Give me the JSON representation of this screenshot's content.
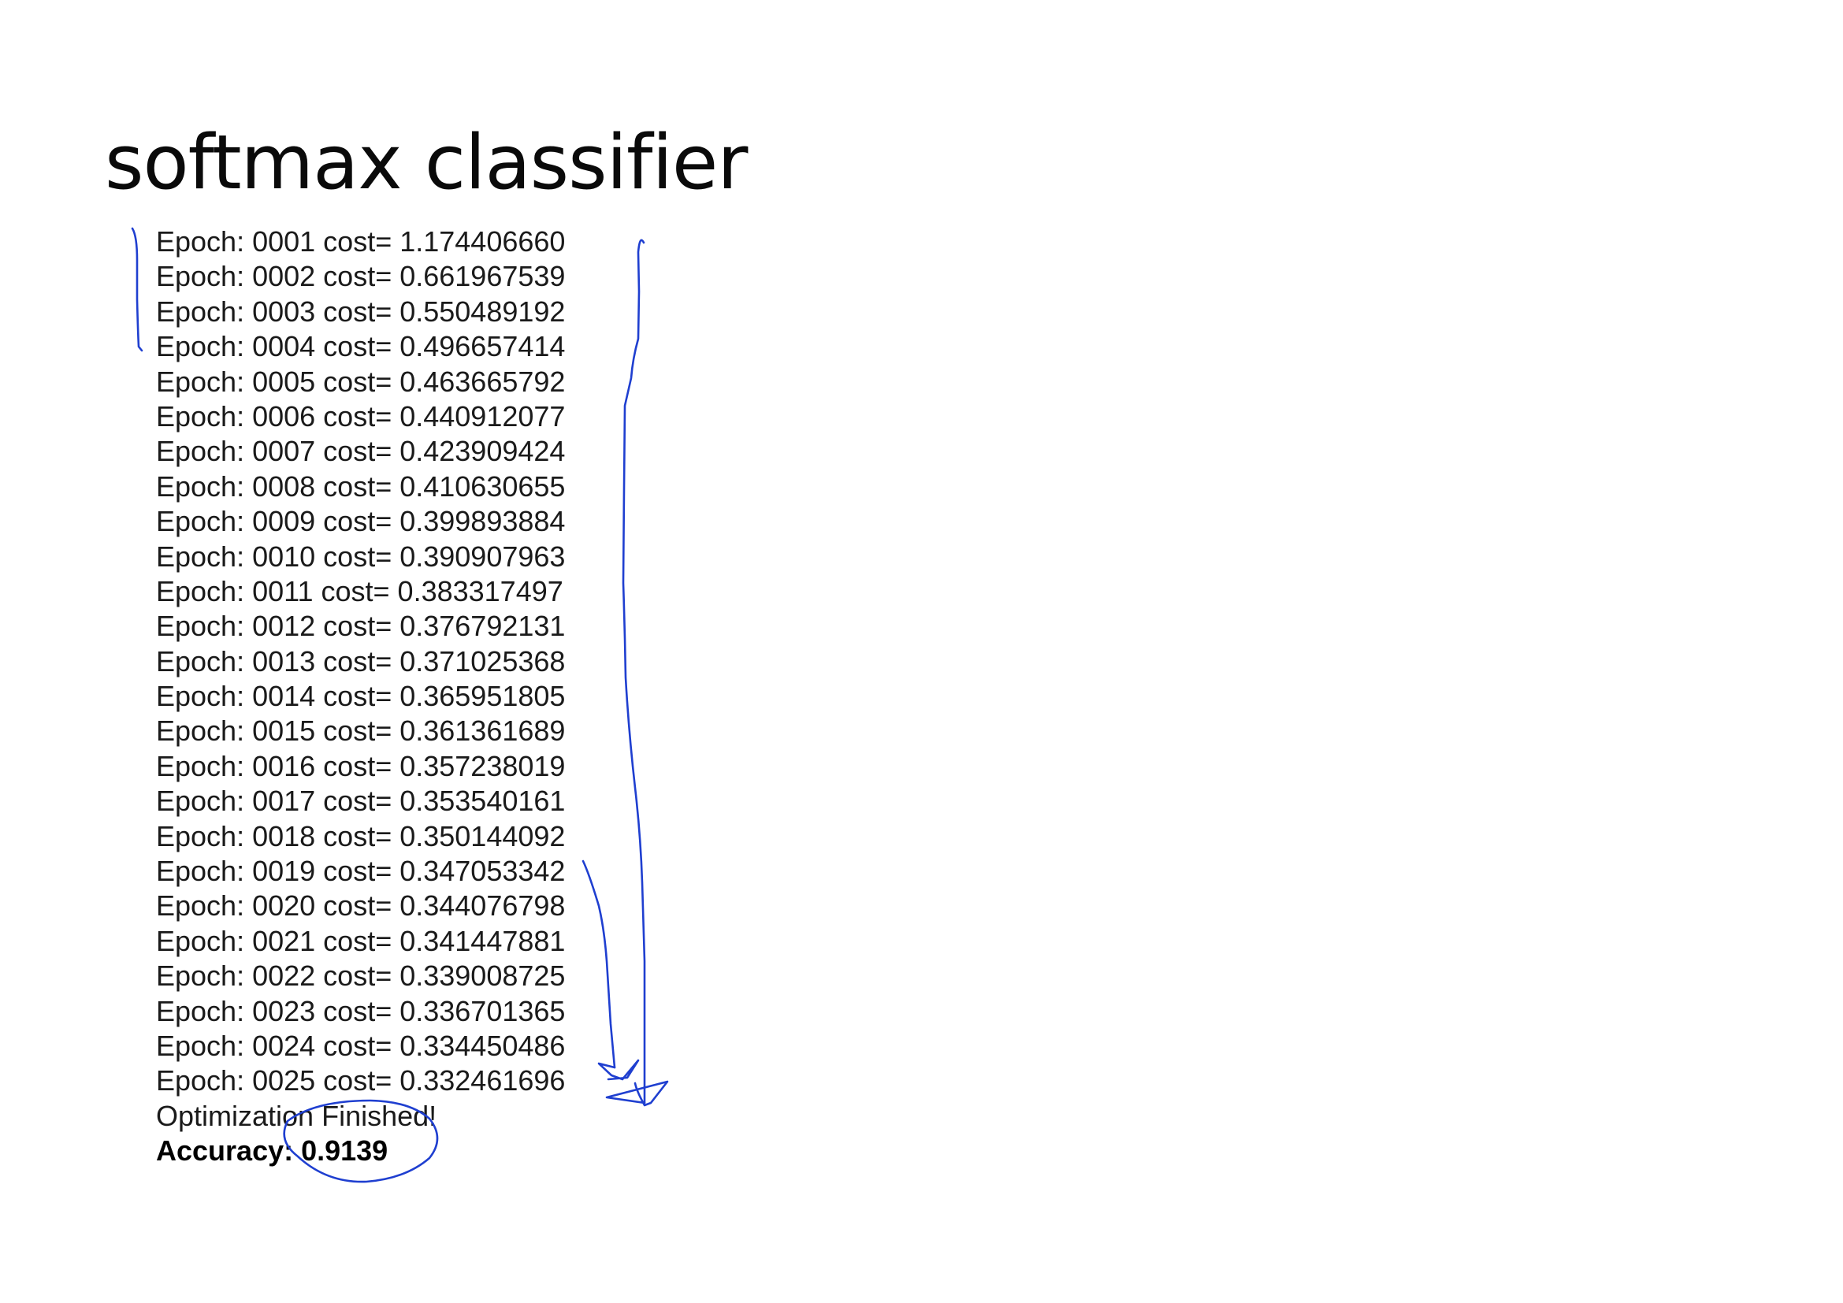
{
  "slide": {
    "title": "softmax classifier"
  },
  "training_log": {
    "epochs": [
      {
        "line": "Epoch: 0001 cost= 1.174406660"
      },
      {
        "line": "Epoch: 0002 cost= 0.661967539"
      },
      {
        "line": "Epoch: 0003 cost= 0.550489192"
      },
      {
        "line": "Epoch: 0004 cost= 0.496657414"
      },
      {
        "line": "Epoch: 0005 cost= 0.463665792"
      },
      {
        "line": "Epoch: 0006 cost= 0.440912077"
      },
      {
        "line": "Epoch: 0007 cost= 0.423909424"
      },
      {
        "line": "Epoch: 0008 cost= 0.410630655"
      },
      {
        "line": "Epoch: 0009 cost= 0.399893884"
      },
      {
        "line": "Epoch: 0010 cost= 0.390907963"
      },
      {
        "line": "Epoch: 0011 cost= 0.383317497"
      },
      {
        "line": "Epoch: 0012 cost= 0.376792131"
      },
      {
        "line": "Epoch: 0013 cost= 0.371025368"
      },
      {
        "line": "Epoch: 0014 cost= 0.365951805"
      },
      {
        "line": "Epoch: 0015 cost= 0.361361689"
      },
      {
        "line": "Epoch: 0016 cost= 0.357238019"
      },
      {
        "line": "Epoch: 0017 cost= 0.353540161"
      },
      {
        "line": "Epoch: 0018 cost= 0.350144092"
      },
      {
        "line": "Epoch: 0019 cost= 0.347053342"
      },
      {
        "line": "Epoch: 0020 cost= 0.344076798"
      },
      {
        "line": "Epoch: 0021 cost= 0.341447881"
      },
      {
        "line": "Epoch: 0022 cost= 0.339008725"
      },
      {
        "line": "Epoch: 0023 cost= 0.336701365"
      },
      {
        "line": "Epoch: 0024 cost= 0.334450486"
      },
      {
        "line": "Epoch: 0025 cost= 0.332461696"
      }
    ],
    "finished_message": "Optimization Finished!",
    "accuracy_text": "Accuracy: 0.9139"
  },
  "annotations": {
    "ink_color": "#1f3fd0"
  }
}
